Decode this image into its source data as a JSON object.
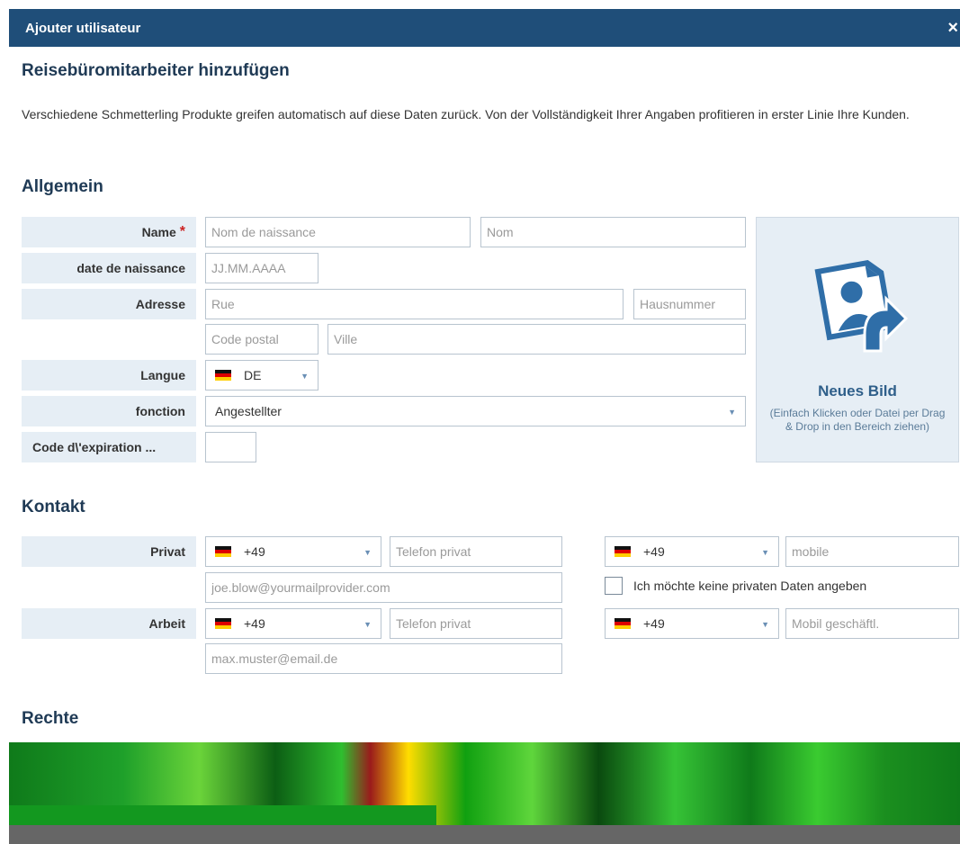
{
  "dialog": {
    "title": "Ajouter utilisateur",
    "close": "×"
  },
  "page_title": "Reisebüromitarbeiter hinzufügen",
  "intro": "Verschiedene Schmetterling Produkte greifen automatisch auf diese Daten zurück. Von der Vollständigkeit Ihrer Angaben profitieren in erster Linie Ihre Kunden.",
  "sections": {
    "general": "Allgemein",
    "contact": "Kontakt",
    "rights": "Rechte"
  },
  "general": {
    "name_label": "Name",
    "required_mark": "*",
    "birth_name_placeholder": "Nom de naissance",
    "name_placeholder": "Nom",
    "birthdate_label": "date de naissance",
    "birthdate_placeholder": "JJ.MM.AAAA",
    "address_label": "Adresse",
    "street_placeholder": "Rue",
    "house_number_placeholder": "Hausnummer",
    "postal_code_placeholder": "Code postal",
    "city_placeholder": "Ville",
    "language_label": "Langue",
    "language_value": "DE",
    "function_label": "fonction",
    "function_value": "Angestellter",
    "expiration_label": "Code d\\'expiration ...",
    "expiration_value": ""
  },
  "upload": {
    "title": "Neues Bild",
    "hint": "(Einfach Klicken oder Datei per Drag & Drop in den Bereich ziehen)"
  },
  "contact": {
    "private_label": "Privat",
    "private_phone_code": "+49",
    "private_phone_placeholder": "Telefon privat",
    "private_mobile_code": "+49",
    "private_mobile_placeholder": "mobile",
    "private_email_placeholder": "joe.blow@yourmailprovider.com",
    "no_private_data_label": "Ich möchte keine privaten Daten angeben",
    "work_label": "Arbeit",
    "work_phone_code": "+49",
    "work_phone_placeholder": "Telefon privat",
    "work_mobile_code": "+49",
    "work_mobile_placeholder": "Mobil geschäftl.",
    "work_email_placeholder": "max.muster@email.de"
  },
  "colors": {
    "titlebar": "#1f4e79",
    "label_bg": "#e6eef5",
    "heading": "#1f3a55",
    "required": "#cc2222"
  }
}
